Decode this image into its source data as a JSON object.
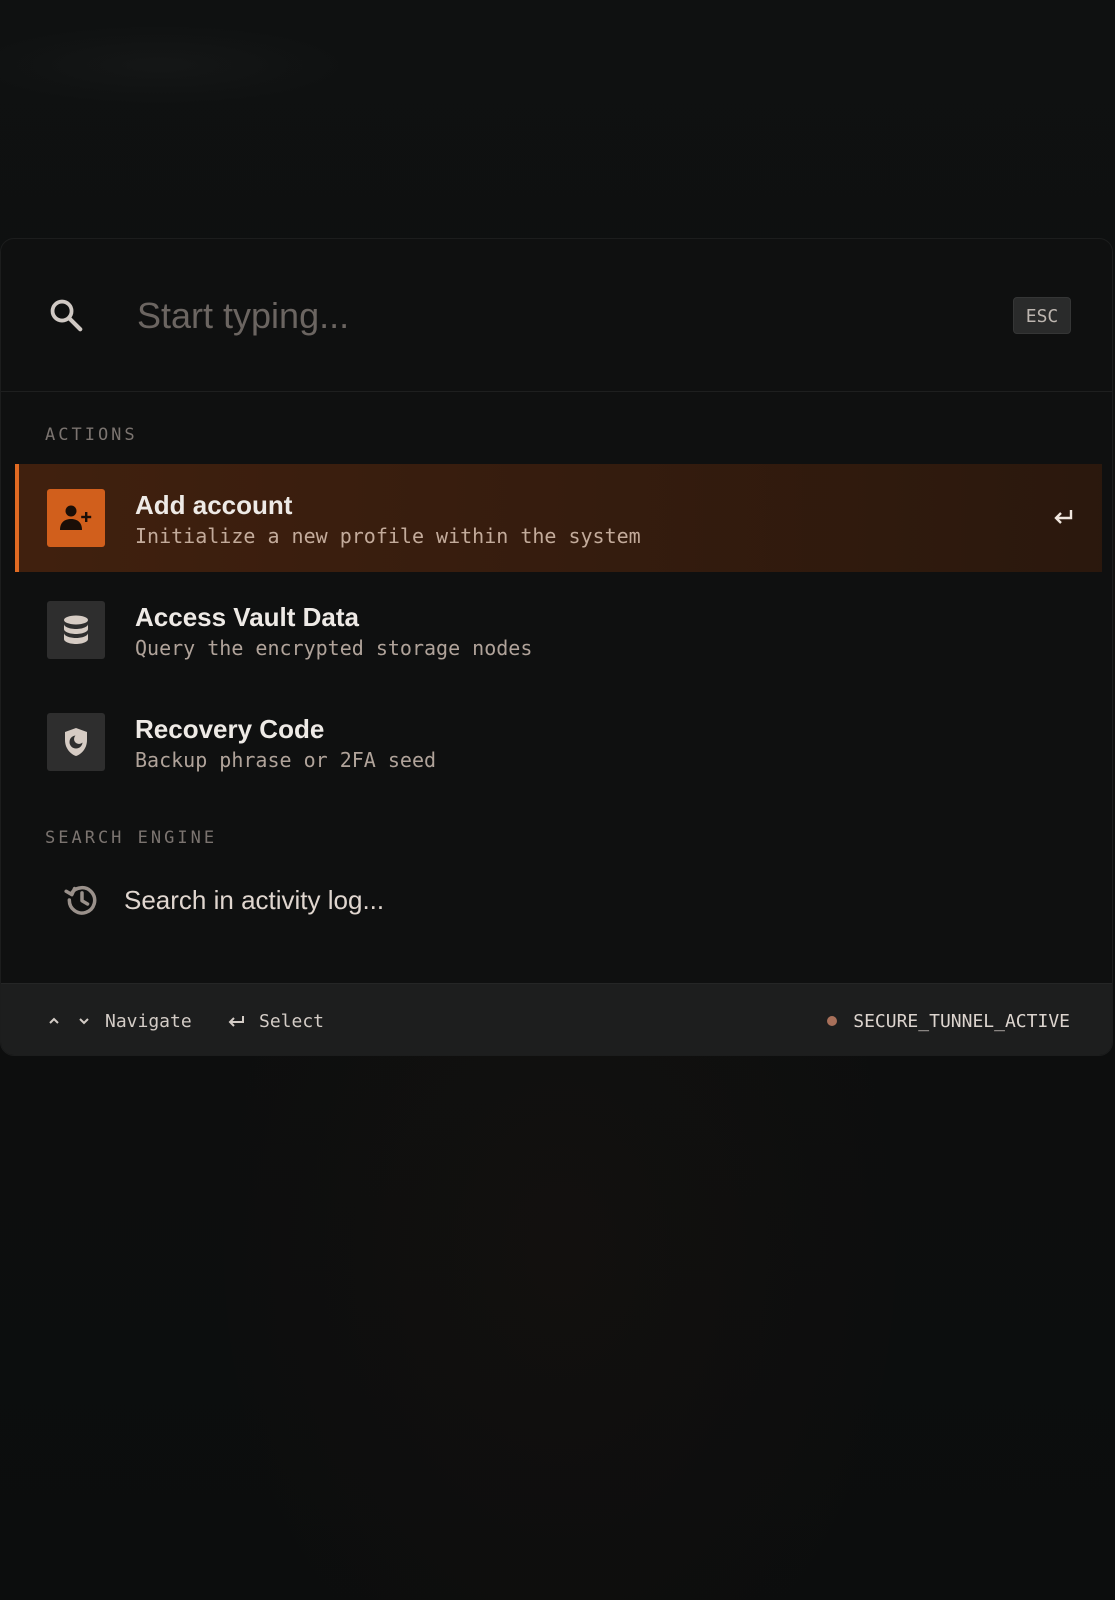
{
  "search": {
    "placeholder": "Start typing...",
    "value": "",
    "esc_label": "ESC"
  },
  "sections": {
    "actions_label": "ACTIONS",
    "search_engine_label": "SEARCH ENGINE"
  },
  "actions": [
    {
      "title": "Add account",
      "description": "Initialize a new profile within the system",
      "icon": "person-add-icon",
      "active": true
    },
    {
      "title": "Access Vault Data",
      "description": "Query the encrypted storage nodes",
      "icon": "database-icon",
      "active": false
    },
    {
      "title": "Recovery Code",
      "description": "Backup phrase or 2FA seed",
      "icon": "shield-moon-icon",
      "active": false
    }
  ],
  "search_engine": {
    "label": "Search in activity log...",
    "icon": "history-icon"
  },
  "footer": {
    "navigate_label": "Navigate",
    "select_label": "Select",
    "status_label": "SECURE_TUNNEL_ACTIVE"
  },
  "colors": {
    "accent": "#e06a22",
    "active_icon_bg": "#d15f1c",
    "status_dot": "#a8705a"
  }
}
